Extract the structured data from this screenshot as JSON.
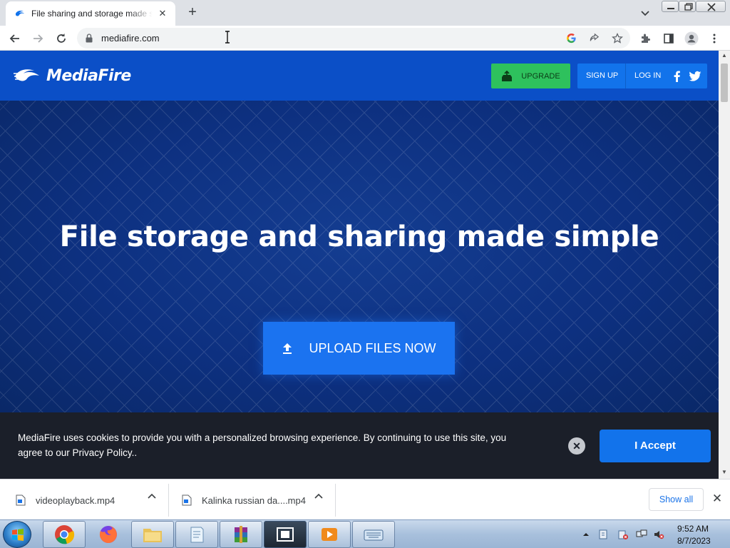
{
  "browser": {
    "tab_title": "File sharing and storage made simple",
    "tab_close": "✕",
    "new_tab": "+",
    "url": "mediafire.com"
  },
  "site": {
    "logo_text": "MediaFire",
    "upgrade_label": "UPGRADE",
    "signup_label": "SIGN UP",
    "login_label": "LOG IN",
    "hero_title": "File storage and sharing made simple",
    "upload_label": "UPLOAD FILES NOW"
  },
  "cookie": {
    "text": "MediaFire uses cookies to provide you with a personalized browsing experience. By continuing to use this site, you agree to our Privacy Policy..",
    "close": "✕",
    "accept_label": "I Accept"
  },
  "downloads": {
    "items": [
      {
        "name": "videoplayback.mp4"
      },
      {
        "name": "Kalinka russian da....mp4"
      }
    ],
    "show_all": "Show all",
    "close": "✕"
  },
  "taskbar": {
    "time": "9:52 AM",
    "date": "8/7/2023"
  },
  "colors": {
    "brand_blue": "#0b4fc7",
    "hero_navy": "#0d3080",
    "upgrade_green": "#2ec15d",
    "button_blue": "#1b73f0",
    "cookie_bg": "#1b1f29"
  }
}
